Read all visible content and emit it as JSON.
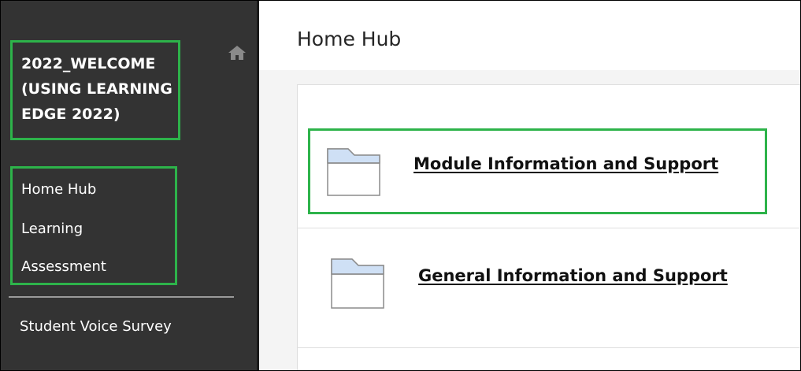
{
  "course": {
    "title": "2022_WELCOME (USING LEARNING EDGE 2022)"
  },
  "sidebar": {
    "home_icon": "home-icon",
    "nav_items": [
      {
        "label": "Home Hub"
      },
      {
        "label": "Learning"
      },
      {
        "label": "Assessment"
      }
    ],
    "extra_item": {
      "label": "Student Voice Survey"
    }
  },
  "main": {
    "page_title": "Home Hub",
    "items": [
      {
        "label": "Module Information and Support",
        "icon": "folder-icon"
      },
      {
        "label": "General Information and Support",
        "icon": "folder-icon"
      }
    ]
  },
  "colors": {
    "sidebar_bg": "#333333",
    "highlight": "#2db34a",
    "folder_fill": "#cfe0f5"
  }
}
